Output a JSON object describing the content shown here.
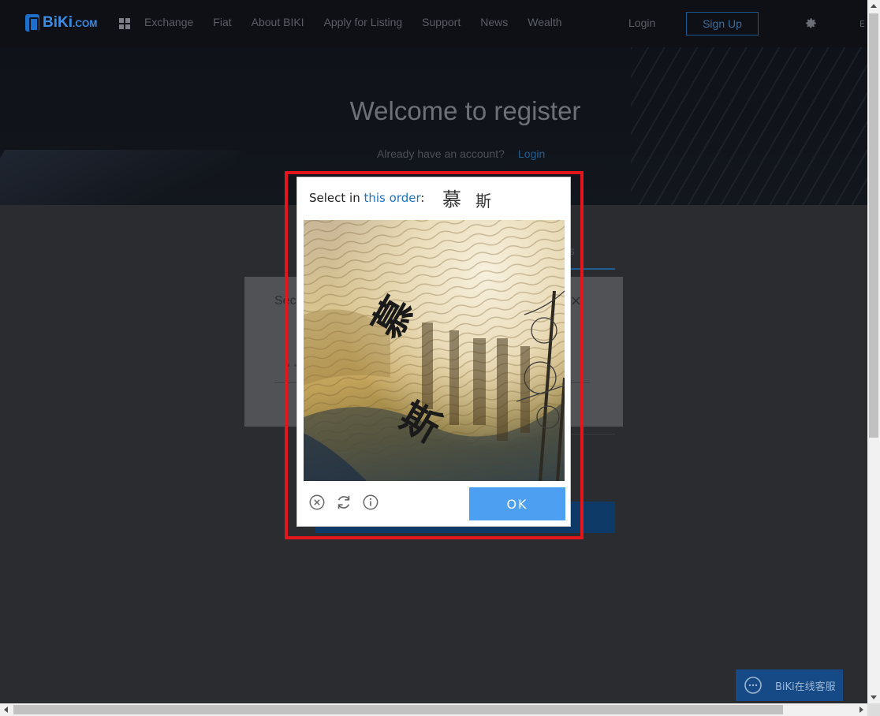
{
  "brand": {
    "name": "BiKi",
    "suffix": ".COM"
  },
  "nav": {
    "items": [
      "Exchange",
      "Fiat",
      "About BIKI",
      "Apply for Listing",
      "Support",
      "News",
      "Wealth"
    ],
    "login": "Login",
    "signup": "Sign Up",
    "lang_cut": "E"
  },
  "hero": {
    "title": "Welcome to register",
    "subtitle": "Already have an account?",
    "login_link": "Login"
  },
  "background_dialog": {
    "title_cut": "Sec",
    "close": "×",
    "dots": "•••",
    "tab_cut": "s"
  },
  "captcha": {
    "instruction_prefix": "Select in ",
    "instruction_link": "this order",
    "instruction_suffix": ":",
    "target_chars": [
      "慕",
      "斯"
    ],
    "image_chars": [
      "慕",
      "斯"
    ],
    "ok_label": "OK",
    "tools": [
      "close-circle-icon",
      "refresh-icon",
      "info-icon"
    ]
  },
  "chat": {
    "label": "BiKi在线客服"
  },
  "colors": {
    "accent": "#4d9ff2",
    "highlight": "#e3161c",
    "link": "#1e73be"
  }
}
